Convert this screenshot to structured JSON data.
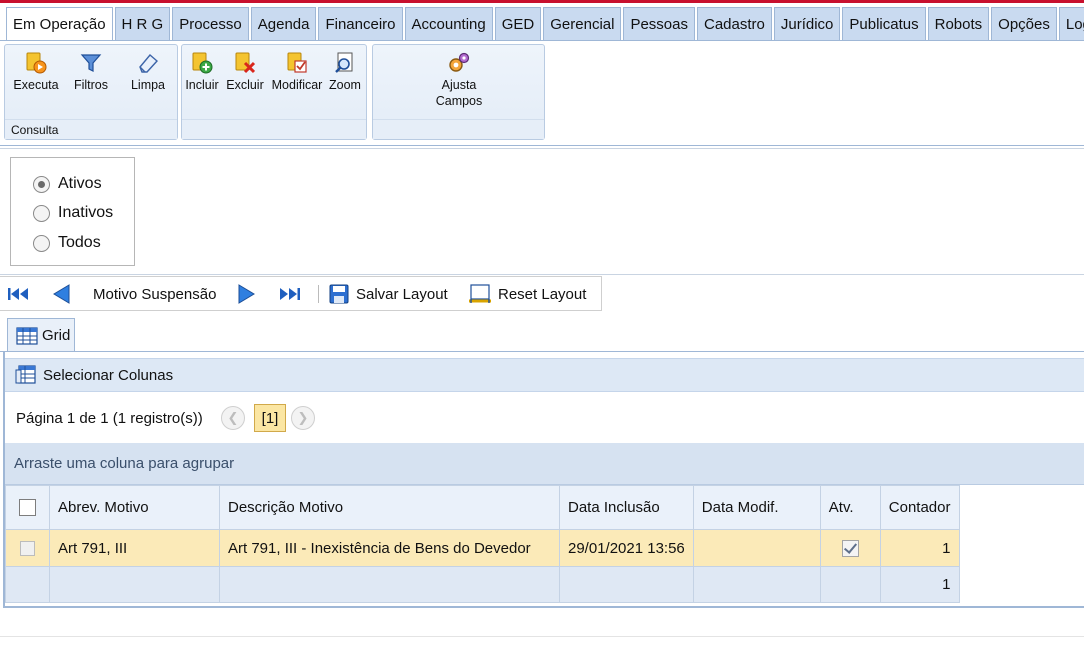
{
  "menu": {
    "tabs": [
      {
        "label": "Em Operação",
        "active": true
      },
      {
        "label": "H R G"
      },
      {
        "label": "Processo"
      },
      {
        "label": "Agenda"
      },
      {
        "label": "Financeiro"
      },
      {
        "label": "Accounting"
      },
      {
        "label": "GED"
      },
      {
        "label": "Gerencial"
      },
      {
        "label": "Pessoas"
      },
      {
        "label": "Cadastro"
      },
      {
        "label": "Jurídico"
      },
      {
        "label": "Publicatus"
      },
      {
        "label": "Robots"
      },
      {
        "label": "Opções"
      },
      {
        "label": "Login"
      }
    ]
  },
  "ribbon": {
    "consulta": {
      "group_label": "Consulta",
      "executa": "Executa",
      "filtros": "Filtros",
      "limpa": "Limpa"
    },
    "edit": {
      "incluir": "Incluir",
      "excluir": "Excluir",
      "modificar": "Modificar",
      "zoom": "Zoom"
    },
    "ajusta": {
      "line1": "Ajusta",
      "line2": "Campos"
    }
  },
  "filter": {
    "options": [
      "Ativos",
      "Inativos",
      "Todos"
    ],
    "selected": "Ativos"
  },
  "navbar": {
    "current_record": "Motivo Suspensão",
    "save_layout": "Salvar Layout",
    "reset_layout": "Reset Layout"
  },
  "grid": {
    "tab_label": "Grid",
    "select_columns": "Selecionar Colunas",
    "pager_text": "Página 1 de 1 (1 registro(s))",
    "current_page": "[1]",
    "group_hint": "Arraste uma coluna para agrupar",
    "columns": [
      "Abrev. Motivo",
      "Descrição Motivo",
      "Data Inclusão",
      "Data Modif.",
      "Atv.",
      "Contador"
    ],
    "rows": [
      {
        "abrev": "Art 791, III",
        "descricao": "Art 791, III - Inexistência de Bens do Devedor",
        "data_inclusao": "29/01/2021 13:56",
        "data_modif": "",
        "ativo": true,
        "contador": "1"
      }
    ],
    "footer_total": "1"
  },
  "colors": {
    "accent_red": "#c8102e",
    "tab_blue": "#c9daf0",
    "selected_row": "#fbeab8"
  }
}
